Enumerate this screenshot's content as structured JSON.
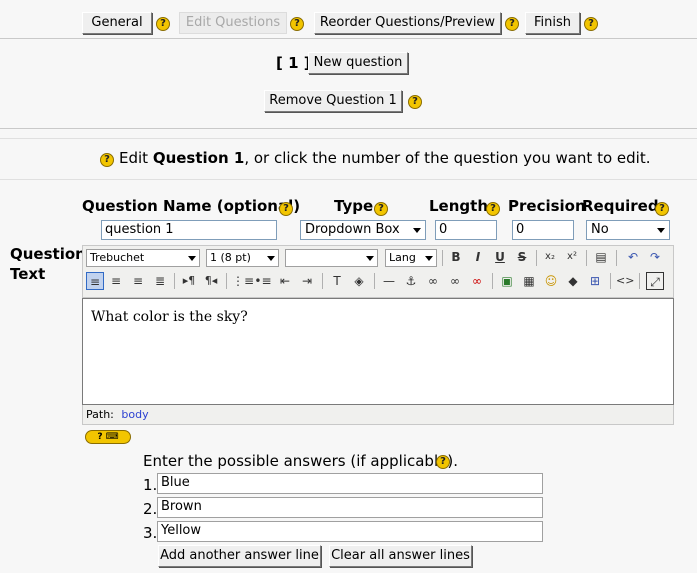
{
  "tabs": {
    "general": "General",
    "edit_questions": "Edit Questions",
    "reorder": "Reorder Questions/Preview",
    "finish": "Finish"
  },
  "question_nav": {
    "current": "[ 1 ]",
    "new_question": "New question",
    "remove_question": "Remove Question 1"
  },
  "instruction": {
    "prefix": "Edit ",
    "bold": "Question 1",
    "suffix": ", or click the number of the question you want to edit."
  },
  "fields": {
    "name_label": "Question Name (optional)",
    "name_value": "question 1",
    "type_label": "Type",
    "type_value": "Dropdown Box",
    "length_label": "Length",
    "length_value": "0",
    "precision_label": "Precision",
    "precision_value": "0",
    "required_label": "Required",
    "required_value": "No"
  },
  "editor": {
    "label": "Question\nText",
    "font": "Trebuchet",
    "size": "1 (8 pt)",
    "format": "",
    "lang": "Lang",
    "content": "What color is the sky?",
    "path_label": "Path:",
    "path_value": "body"
  },
  "answers": {
    "prompt": "Enter the possible answers (if applicable).",
    "items": [
      {
        "num": "1.",
        "value": "Blue"
      },
      {
        "num": "2.",
        "value": "Brown"
      },
      {
        "num": "3.",
        "value": "Yellow"
      }
    ],
    "add_line": "Add another answer line",
    "clear_lines": "Clear all answer lines"
  },
  "icons": {
    "help": "?",
    "bold": "B",
    "italic": "I",
    "underline": "U",
    "strike": "S"
  },
  "colors": {
    "link": "#2a3fd1",
    "help_bg": "#f2c500"
  }
}
